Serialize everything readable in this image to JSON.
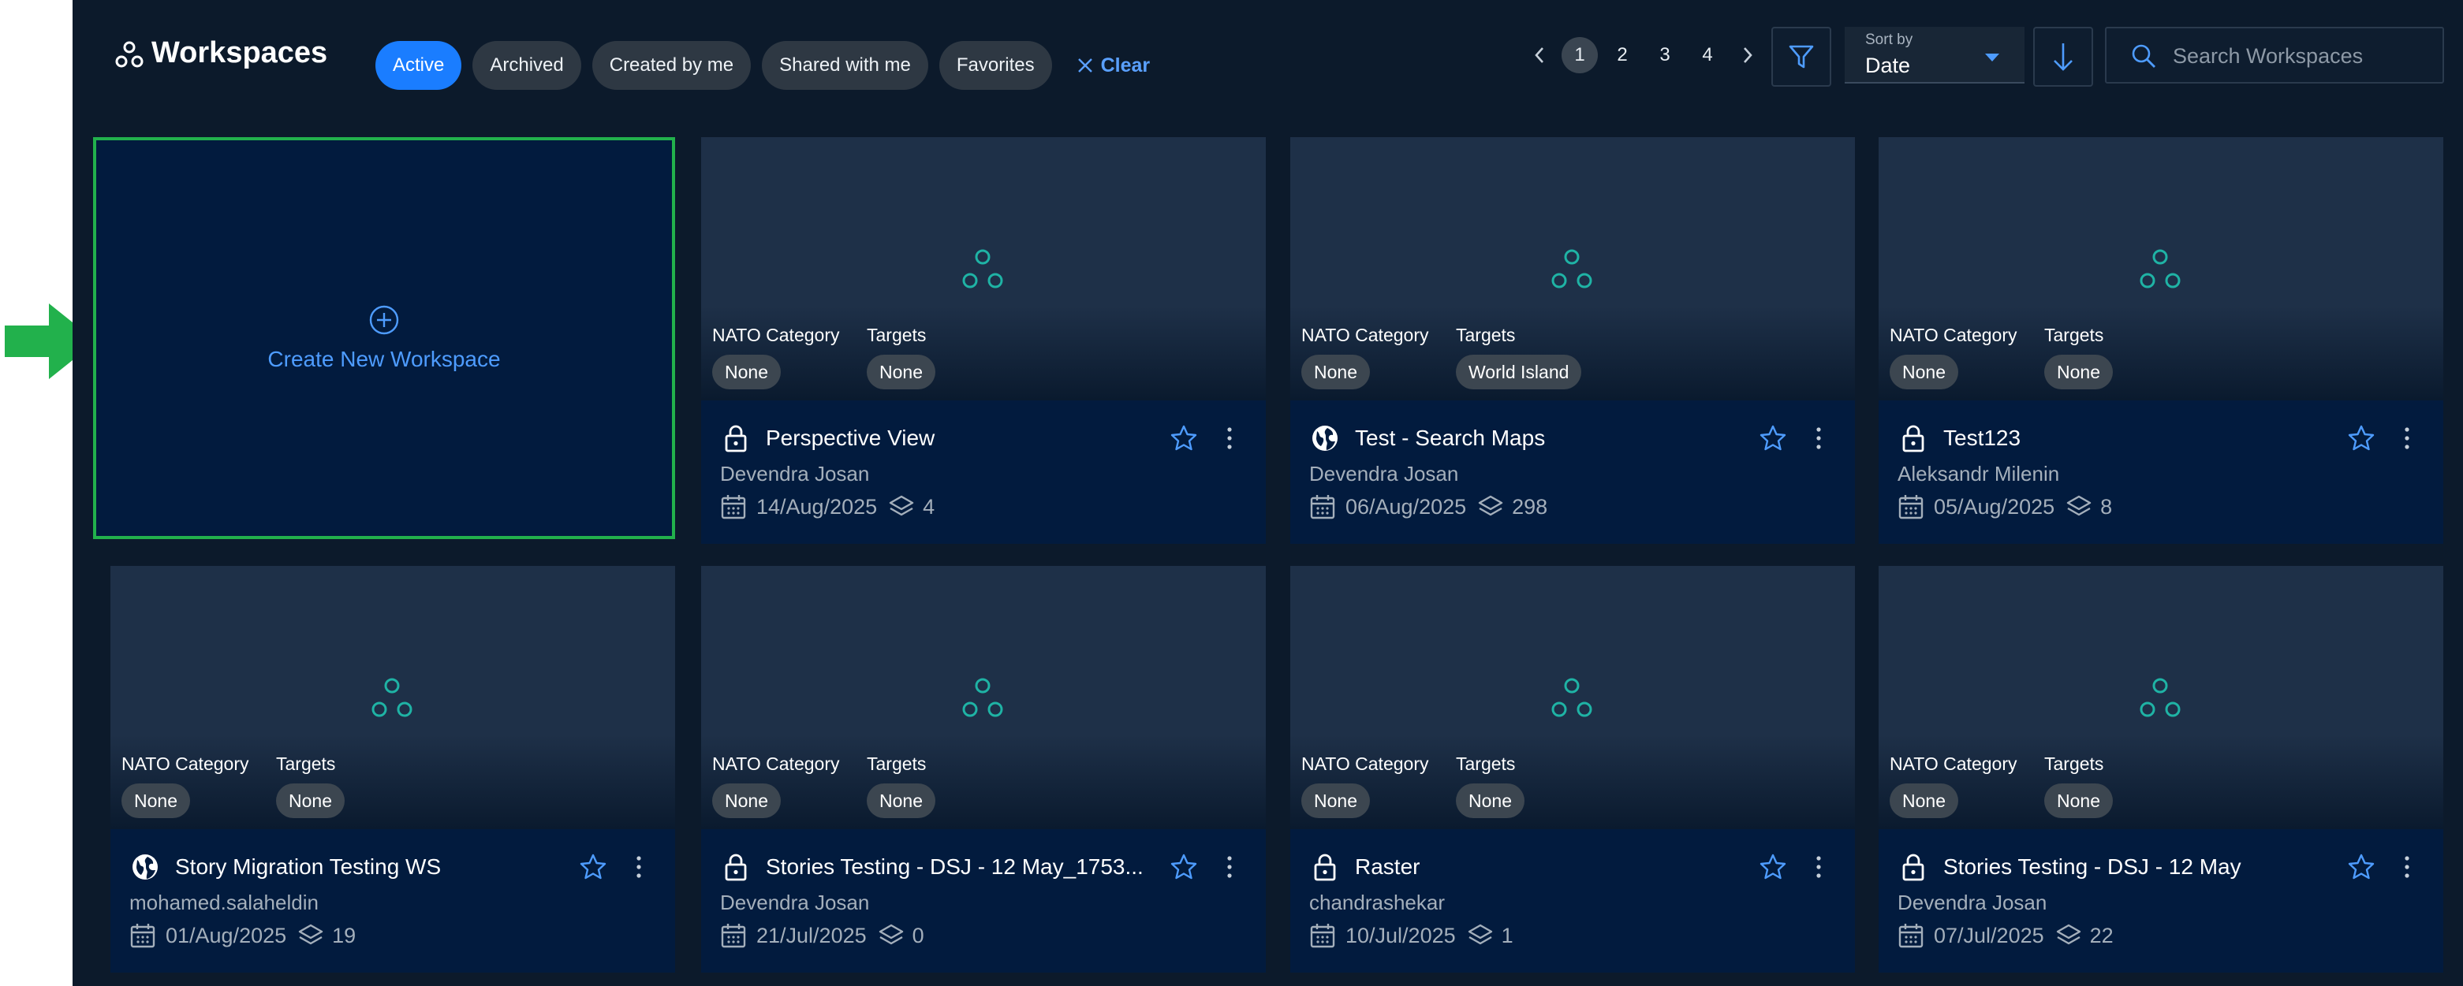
{
  "header": {
    "title": "Workspaces",
    "filters": [
      "Active",
      "Archived",
      "Created by me",
      "Shared with me",
      "Favorites"
    ],
    "active_filter": "Active",
    "clear_label": "Clear",
    "pages": [
      "1",
      "2",
      "3",
      "4"
    ],
    "current_page": "1",
    "sort_label": "Sort by",
    "sort_value": "Date",
    "search_placeholder": "Search Workspaces"
  },
  "create_card": {
    "label": "Create New Workspace"
  },
  "meta_labels": {
    "category": "NATO Category",
    "targets": "Targets"
  },
  "workspaces": [
    {
      "title": "Perspective View",
      "owner": "Devendra Josan",
      "date": "14/Aug/2025",
      "layers": "4",
      "category": "None",
      "targets": "None",
      "visibility": "lock-icon"
    },
    {
      "title": "Test - Search Maps",
      "owner": "Devendra Josan",
      "date": "06/Aug/2025",
      "layers": "298",
      "category": "None",
      "targets": "World Island",
      "visibility": "globe-icon"
    },
    {
      "title": "Test123",
      "owner": "Aleksandr Milenin",
      "date": "05/Aug/2025",
      "layers": "8",
      "category": "None",
      "targets": "None",
      "visibility": "lock-icon"
    },
    {
      "title": "Story Migration Testing WS",
      "owner": "mohamed.salaheldin",
      "date": "01/Aug/2025",
      "layers": "19",
      "category": "None",
      "targets": "None",
      "visibility": "globe-icon"
    },
    {
      "title": "Stories Testing - DSJ - 12 May_1753...",
      "owner": "Devendra Josan",
      "date": "21/Jul/2025",
      "layers": "0",
      "category": "None",
      "targets": "None",
      "visibility": "lock-icon"
    },
    {
      "title": "Raster",
      "owner": "chandrashekar",
      "date": "10/Jul/2025",
      "layers": "1",
      "category": "None",
      "targets": "None",
      "visibility": "lock-icon"
    },
    {
      "title": "Stories Testing - DSJ - 12 May",
      "owner": "Devendra Josan",
      "date": "07/Jul/2025",
      "layers": "22",
      "category": "None",
      "targets": "None",
      "visibility": "lock-icon"
    }
  ],
  "colors": {
    "background": "#0c1a2b",
    "card": "#021b3e",
    "accent": "#1a7dff",
    "teal_icon": "#1fb3a5",
    "highlight_border": "#22b14c"
  }
}
